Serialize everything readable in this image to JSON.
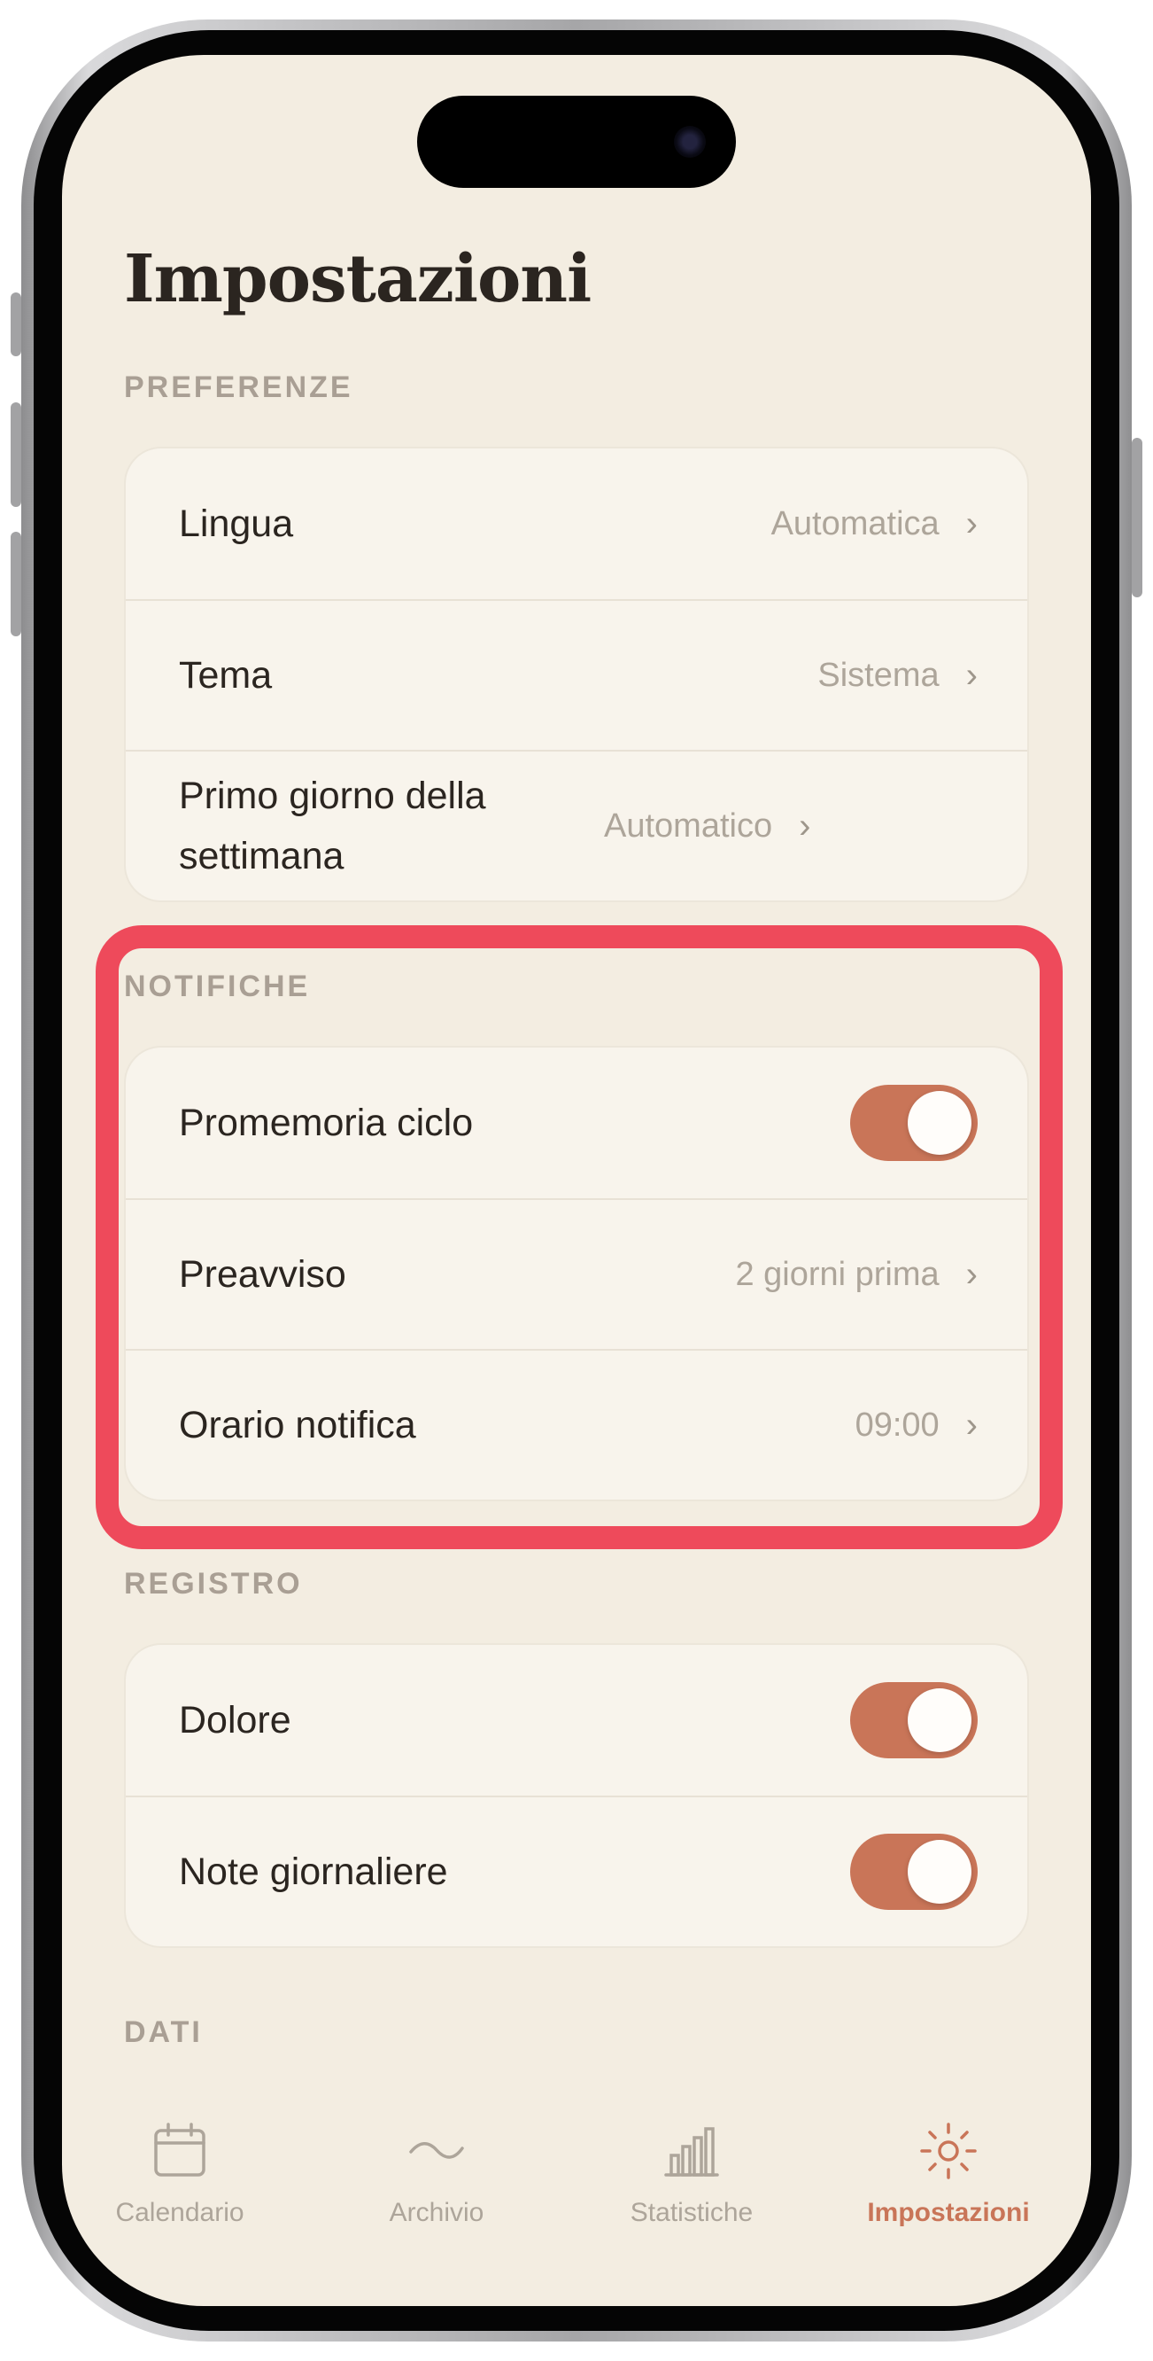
{
  "screen": {
    "title": "Impostazioni"
  },
  "sections": {
    "preferenze": {
      "label": "PREFERENZE",
      "rows": [
        {
          "label": "Lingua",
          "value": "Automatica"
        },
        {
          "label": "Tema",
          "value": "Sistema"
        },
        {
          "label": "Primo giorno della settimana",
          "value": "Automatico"
        }
      ]
    },
    "notifiche": {
      "label": "NOTIFICHE",
      "rows": [
        {
          "label": "Promemoria ciclo",
          "toggle": true
        },
        {
          "label": "Preavviso",
          "value": "2 giorni prima"
        },
        {
          "label": "Orario notifica",
          "value": "09:00"
        }
      ]
    },
    "registro": {
      "label": "REGISTRO",
      "rows": [
        {
          "label": "Dolore",
          "toggle": true
        },
        {
          "label": "Note giornaliere",
          "toggle": true
        }
      ]
    },
    "dati": {
      "label": "DATI"
    }
  },
  "tabbar": {
    "items": [
      {
        "label": "Calendario",
        "icon": "calendar-icon",
        "active": false
      },
      {
        "label": "Archivio",
        "icon": "wave-icon",
        "active": false
      },
      {
        "label": "Statistiche",
        "icon": "bar-chart-icon",
        "active": false
      },
      {
        "label": "Impostazioni",
        "icon": "sun-gear-icon",
        "active": true
      }
    ]
  },
  "colors": {
    "background": "#f3ede1",
    "card": "#f8f4ec",
    "accent": "#c97558",
    "highlight": "#ee4a5b",
    "text": "#2b2520",
    "secondary_text": "#ada59a"
  }
}
